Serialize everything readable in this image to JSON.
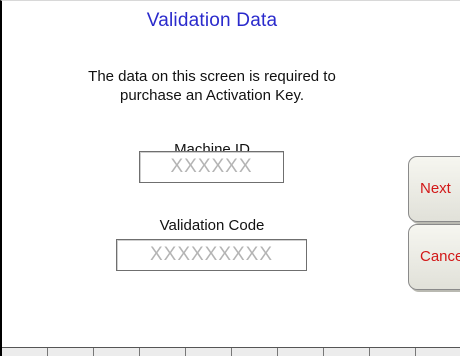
{
  "screen": {
    "title": "Validation Data",
    "message_line1": "The data on this screen is required to",
    "message_line2": "purchase an Activation Key."
  },
  "machine_id": {
    "label": "Machine ID",
    "value": "XXXXXX"
  },
  "validation_code": {
    "label": "Validation Code",
    "value": "XXXXXXXXX"
  },
  "buttons": {
    "next": "Next",
    "cancel": "Cancel"
  },
  "colors": {
    "title": "#2a2acc",
    "button_text": "#d21818",
    "field_text": "#b4b4b4"
  }
}
